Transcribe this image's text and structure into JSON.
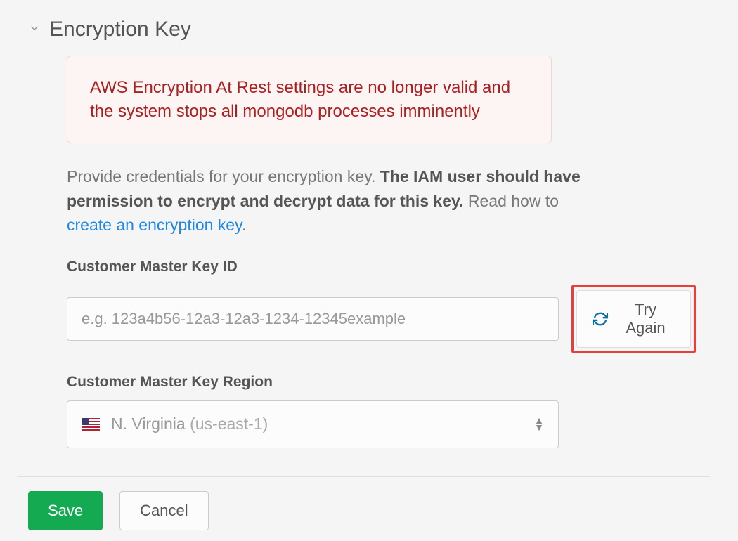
{
  "section": {
    "title": "Encryption Key"
  },
  "alert": {
    "message": "AWS Encryption At Rest settings are no longer valid and the system stops all mongodb processes imminently"
  },
  "description": {
    "prefix": "Provide credentials for your encryption key. ",
    "bold": "The IAM user should have permission to encrypt and decrypt data for this key.",
    "read": " Read how to ",
    "link": "create an encryption key",
    "suffix": "."
  },
  "fields": {
    "keyId": {
      "label": "Customer Master Key ID",
      "placeholder": "e.g. 123a4b56-12a3-12a3-1234-12345example"
    },
    "region": {
      "label": "Customer Master Key Region",
      "selectedName": "N. Virginia ",
      "selectedCode": "(us-east-1)"
    }
  },
  "buttons": {
    "tryAgain": "Try Again",
    "save": "Save",
    "cancel": "Cancel"
  }
}
